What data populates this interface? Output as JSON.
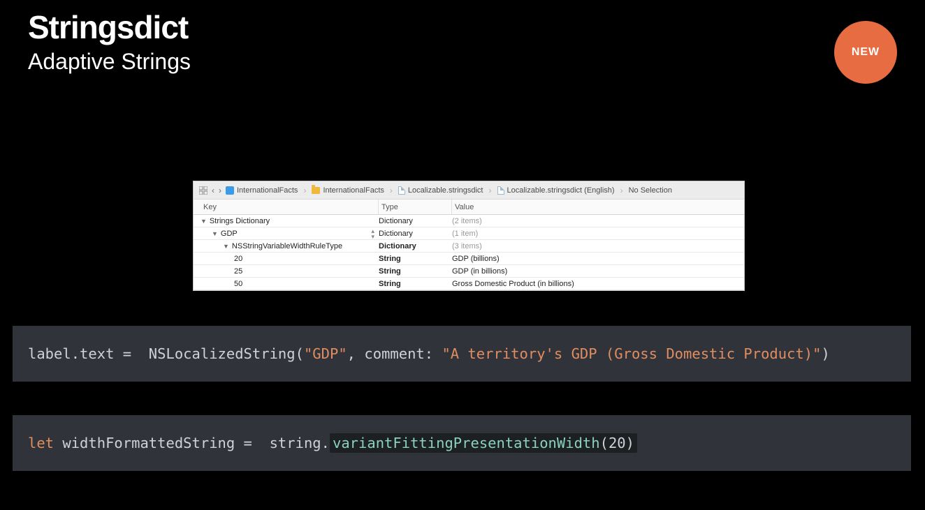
{
  "title": "Stringsdict",
  "subtitle": "Adaptive Strings",
  "badge": "NEW",
  "breadcrumb": {
    "item0": "InternationalFacts",
    "item1": "InternationalFacts",
    "item2": "Localizable.stringsdict",
    "item3": "Localizable.stringsdict (English)",
    "item4": "No Selection"
  },
  "columns": {
    "key": "Key",
    "type": "Type",
    "value": "Value"
  },
  "rows": [
    {
      "indent": 0,
      "key": "Strings Dictionary",
      "type": "Dictionary",
      "value": "(2 items)",
      "disclose": true,
      "gray": true,
      "selectedStepper": false
    },
    {
      "indent": 1,
      "key": "GDP",
      "type": "Dictionary",
      "value": "(1 item)",
      "disclose": true,
      "gray": true,
      "selectedStepper": true
    },
    {
      "indent": 2,
      "key": "NSStringVariableWidthRuleType",
      "type": "Dictionary",
      "typeBold": true,
      "value": "(3 items)",
      "disclose": true,
      "gray": true
    },
    {
      "indent": 3,
      "key": "20",
      "type": "String",
      "typeBold": true,
      "value": "GDP (billions)"
    },
    {
      "indent": 3,
      "key": "25",
      "type": "String",
      "typeBold": true,
      "value": "GDP (in billions)"
    },
    {
      "indent": 3,
      "key": "50",
      "type": "String",
      "typeBold": true,
      "value": "Gross Domestic Product (in billions)"
    }
  ],
  "code1": {
    "t0": "label.text = ",
    "fn": " NSLocalizedString(",
    "s1": "\"GDP\"",
    "mid": ", comment: ",
    "s2": "\"A territory's GDP (Gross Domestic Product)\"",
    "end": ")"
  },
  "code2": {
    "kw": "let",
    "t0": " widthFormattedString = ",
    "t1": " string.",
    "method": "variantFittingPresentationWidth",
    "open": "(",
    "arg": "20",
    "close": ")"
  }
}
